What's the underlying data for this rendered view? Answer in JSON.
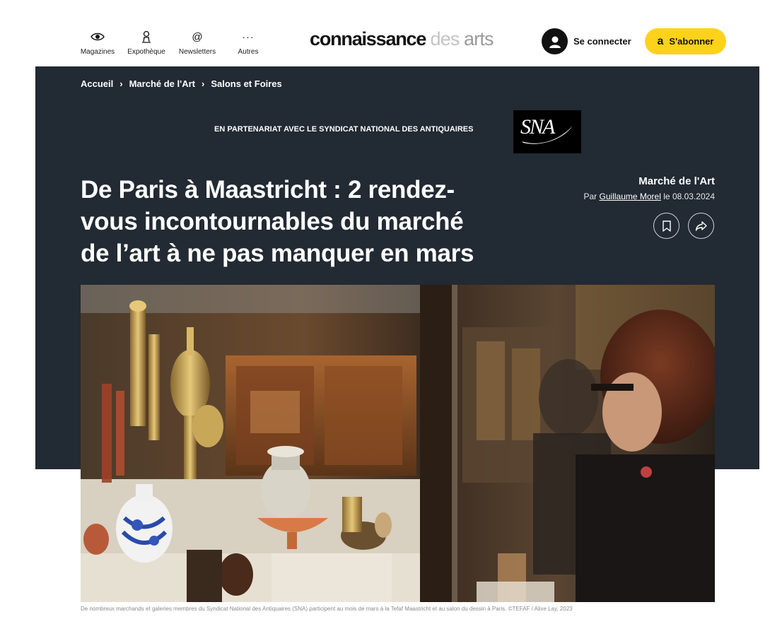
{
  "nav": {
    "items": [
      {
        "label": "Magazines",
        "icon": "eye-icon"
      },
      {
        "label": "Expothèque",
        "icon": "museum-icon"
      },
      {
        "label": "Newsletters",
        "icon": "at-icon"
      },
      {
        "label": "Autres",
        "icon": "more-icon"
      }
    ],
    "more_glyph": "···",
    "at_glyph": "@"
  },
  "logo": {
    "part1": "connaissance",
    "part2": "des",
    "part3": "arts"
  },
  "login": {
    "label": "Se connecter"
  },
  "subscribe": {
    "label": "S'abonner",
    "icon_glyph": "a"
  },
  "breadcrumb": [
    "Accueil",
    "Marché de l'Art",
    "Salons et Foires"
  ],
  "breadcrumb_sep": "›",
  "partner": {
    "text": "EN PARTENARIAT AVEC LE SYNDICAT NATIONAL DES ANTIQUAIRES",
    "logo_text": "SNA"
  },
  "article": {
    "title": "De Paris à Maastricht : 2 rendez-vous incontournables du marché de l’art à ne pas manquer en mars",
    "category": "Marché de l'Art",
    "by_prefix": "Par",
    "author": "Guillaume Morel",
    "date_prefix": "le",
    "date": "08.03.2024"
  },
  "photo": {
    "caption": "De nombreux marchands et galeries membres du Syndicat National des Antiquaires (SNA) participent au mois de mars à la Tefaf Maastricht et au salon du dessin à Paris. ©TEFAF / Alixe Lay, 2023"
  },
  "colors": {
    "band": "#222a33",
    "accent": "#fdd21a"
  }
}
